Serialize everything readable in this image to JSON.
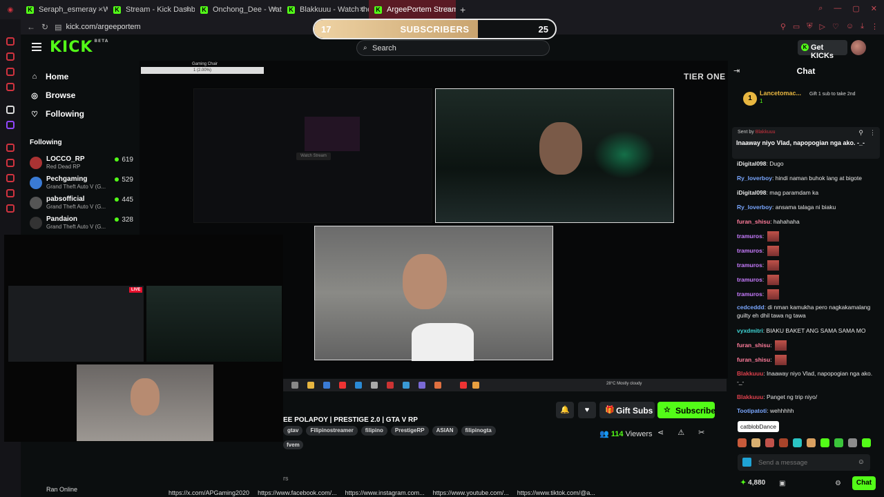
{
  "browser": {
    "tabs": [
      {
        "label": "Seraph_esmeray - Watch"
      },
      {
        "label": "Stream - Kick Dashboard"
      },
      {
        "label": "Onchong_Dee - Watch th"
      },
      {
        "label": "Blakkuuu - Watch the VO"
      },
      {
        "label": "ArgeePortem Stream - W",
        "active": true
      }
    ],
    "url": "kick.com/argeeportem"
  },
  "sub_goal": {
    "current": "17",
    "label": "SUBSCRIBERS",
    "target": "25",
    "progress_fraction": 0.68
  },
  "header": {
    "search_placeholder": "Search",
    "get_kicks": "Get KICKs"
  },
  "sidebar": {
    "nav": [
      {
        "label": "Home",
        "icon": "home-icon"
      },
      {
        "label": "Browse",
        "icon": "compass-icon"
      },
      {
        "label": "Following",
        "icon": "heart-icon"
      }
    ],
    "following_heading": "Following",
    "following": [
      {
        "name": "LOCCO_RP",
        "game": "Red Dead RP",
        "viewers": "619"
      },
      {
        "name": "Pechgaming",
        "game": "Grand Theft Auto V (G...",
        "viewers": "529"
      },
      {
        "name": "pabsofficial",
        "game": "Grand Theft Auto V (G...",
        "viewers": "445"
      },
      {
        "name": "Pandaion",
        "game": "Grand Theft Auto V (G...",
        "viewers": "328"
      }
    ]
  },
  "stream": {
    "gaming_chair_label": "Gaming Chair",
    "gaming_chair_value": "1 (2.00%)",
    "watch_stream": "Watch Stream",
    "tier_one": "TIER ONE",
    "taskbar_weather": "28°C  Mostly cloudy",
    "live_badge": "LIVE"
  },
  "info": {
    "title": "EE POLAPOY | PRESTIGE 2.0 | GTA V RP",
    "tags": [
      "gtav",
      "Filipinostreamer",
      "filipino",
      "PrestigeRP",
      "ASIAN",
      "filipinogta"
    ],
    "tag_partial": "fvem",
    "gift_subs": "Gift Subs",
    "subscribe": "Subscribe",
    "viewers_count": "114",
    "viewers_label": "Viewers",
    "partial_text": "rs",
    "ran_online": "Ran Online",
    "links": [
      "https://x.com/APGaming2020",
      "https://www.facebook.com/...",
      "https://www.instagram.com...",
      "https://www.youtube.com/...",
      "https://www.tiktok.com/@a..."
    ]
  },
  "chat": {
    "heading": "Chat",
    "top_gifter": {
      "rank": "1",
      "name": "Lancetomac...",
      "count": "1",
      "prompt": "Gift 1 sub to take 2nd"
    },
    "pinned": {
      "sent_by_label": "Sent by",
      "sent_by_user": "Blakkuuu",
      "text": "Inaaway niyo Vlad, napopogian nga ako. -_-"
    },
    "messages": [
      {
        "user": "iDigital098",
        "color": "#e8e8e8",
        "text": "Dugo"
      },
      {
        "user": "Ry_loverboy",
        "color": "#7aa7ff",
        "text": "hindi naman buhok lang at bigote"
      },
      {
        "user": "iDigital098",
        "color": "#e8e8e8",
        "text": "mag paramdam ka"
      },
      {
        "user": "Ry_loverboy",
        "color": "#7aa7ff",
        "text": "ansama talaga ni biaku"
      },
      {
        "user": "furan_shisu",
        "color": "#ff7c9b",
        "text": "hahahaha"
      },
      {
        "user": "tramuros",
        "color": "#c87cff",
        "text": "",
        "emote": true
      },
      {
        "user": "tramuros",
        "color": "#c87cff",
        "text": "",
        "emote": true
      },
      {
        "user": "tramuros",
        "color": "#c87cff",
        "text": "",
        "emote": true
      },
      {
        "user": "tramuros",
        "color": "#c87cff",
        "text": "",
        "emote": true
      },
      {
        "user": "tramuros",
        "color": "#c87cff",
        "text": "",
        "emote": true
      },
      {
        "user": "cedceddd",
        "color": "#7aa7ff",
        "text": "di nman kamukha pero nagkakamalang guilty eh dhil tawa ng tawa"
      },
      {
        "user": "vyxdmitri",
        "color": "#3fd6d6",
        "text": "BIAKU BAKET ANG SAMA SAMA MO"
      },
      {
        "user": "furan_shisu",
        "color": "#ff7c9b",
        "text": "",
        "emote": true
      },
      {
        "user": "furan_shisu",
        "color": "#ff7c9b",
        "text": "",
        "emote": true
      },
      {
        "user": "Blakkuuu",
        "color": "#e0414d",
        "text": "Inaaway niyo Vlad, napopogian nga ako. -_-"
      },
      {
        "user": "Blakkuuu",
        "color": "#e0414d",
        "text": "Panget ng trip niyo/"
      },
      {
        "user": "Tootipatoti",
        "color": "#7aa7ff",
        "text": "wehhhhh"
      }
    ],
    "emote_tooltip": "catblobDance",
    "input_placeholder": "Send a message",
    "kicks_balance": "4,880",
    "chat_button": "Chat"
  }
}
